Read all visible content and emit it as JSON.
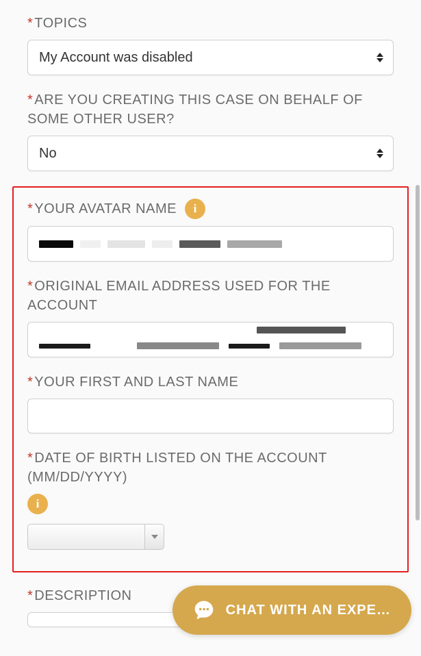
{
  "fields": {
    "topics": {
      "label": "TOPICS",
      "selected": "My Account was disabled"
    },
    "on_behalf": {
      "label": "ARE YOU CREATING THIS CASE ON BEHALF OF SOME OTHER USER?",
      "selected": "No"
    },
    "avatar_name": {
      "label": "YOUR AVATAR NAME",
      "value": "[redacted]"
    },
    "original_email": {
      "label": "ORIGINAL EMAIL ADDRESS USED FOR THE ACCOUNT",
      "value": "[redacted]"
    },
    "full_name": {
      "label": "YOUR FIRST AND LAST NAME",
      "value": ""
    },
    "dob": {
      "label": "DATE OF BIRTH LISTED ON THE ACCOUNT (MM/DD/YYYY)",
      "value": ""
    },
    "description": {
      "label": "DESCRIPTION"
    }
  },
  "chat": {
    "label": "CHAT WITH AN EXPE…"
  }
}
